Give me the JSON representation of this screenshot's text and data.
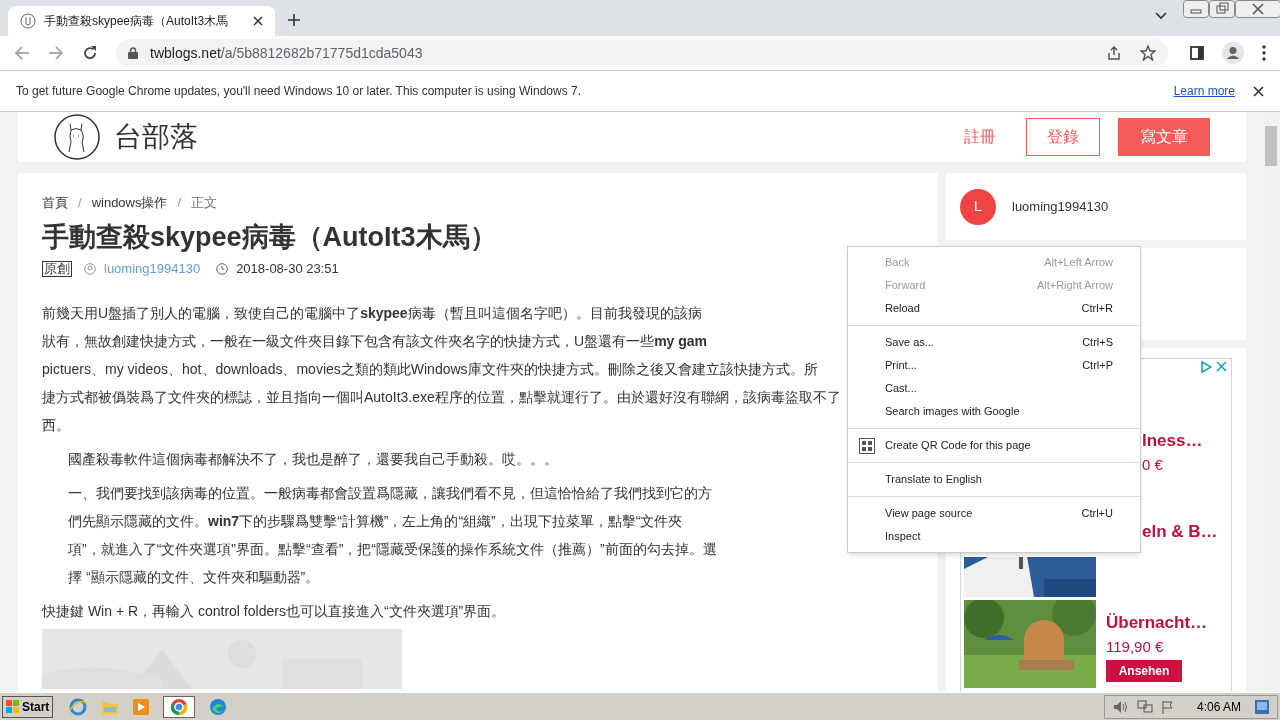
{
  "browser": {
    "tab": {
      "title": "手動查殺skypee病毒（AutoIt3木馬",
      "selected": true
    },
    "url_host": "twblogs.net",
    "url_path": "/a/5b8812682b71775d1cda5043"
  },
  "infobar": {
    "message": "To get future Google Chrome updates, you'll need Windows 10 or later. This computer is using Windows 7.",
    "link": "Learn more"
  },
  "site_header": {
    "logo_text": "台部落",
    "register": "註冊",
    "login": "登錄",
    "write": "寫文章"
  },
  "article": {
    "breadcrumb": [
      "首頁",
      "windows操作",
      "正文"
    ],
    "breadcrumb_separator": "/",
    "title": "手動查殺skypee病毒（AutoIt3木馬）",
    "badge": "原創",
    "author": "luoming1994130",
    "date": "2018-08-30 23:51",
    "paragraphs": [
      {
        "indent": false,
        "lines": [
          " 前幾天用U盤插了別人的電腦，致使自己的電腦中了**skypee**病毒（暫且叫這個名字吧）。目前我發現的該病",
          "狀有，無故創建快捷方式，一般在一級文件夾目錄下包含有該文件夾名字的快捷方式，U盤還有一些**my gam**",
          "pictuers、my videos、hot、downloads、movies之類的類此Windows庫文件夾的快捷方式。刪除之後又會建立該快捷方式。所",
          "捷方式都被僞裝爲了文件夾的標誌，並且指向一個叫AutoIt3.exe程序的位置，點擊就運行了。由於還好沒有聯網，該病毒盜取不了",
          "西。"
        ]
      },
      {
        "indent": true,
        "lines": [
          "國產殺毒軟件這個病毒都解決不了，我也是醉了，還要我自己手動殺。哎。。。"
        ]
      },
      {
        "indent": true,
        "lines": [
          " 一、我們要找到該病毒的位置。一般病毒都會設置爲隱藏，讓我們看不見，但這恰恰給了我們找到它的方",
          "們先顯示隱藏的文件。**win7**下的步驟爲雙擊“計算機”，左上角的“組織”，出現下拉菜單，點擊“文件夾",
          "項”，就進入了“文件夾選項”界面。點擊“查看”，把“隱藏受保護的操作系統文件（推薦）”前面的勾去掉。選",
          "擇 “顯示隱藏的文件、文件夾和驅動器”。"
        ]
      },
      {
        "indent": false,
        "lines": [
          "快捷鍵 Win + R，再輸入 control folders也可以直接進入“文件夾選項”界面。"
        ]
      }
    ]
  },
  "sidebar": {
    "user": {
      "initial": "L",
      "name": "luoming1994130"
    },
    "ads": [
      {
        "kind": "covered",
        "title": "lness…",
        "price": "0 €"
      },
      {
        "kind": "cut",
        "title": "eln & B…"
      },
      {
        "kind": "full",
        "title": "Übernacht…",
        "price": "119,90 €",
        "button": "Ansehen"
      }
    ]
  },
  "context_menu": {
    "groups": [
      [
        {
          "kind": "plain",
          "label": "Back",
          "shortcut": "Alt+Left Arrow",
          "disabled": true
        },
        {
          "kind": "plain",
          "label": "Forward",
          "shortcut": "Alt+Right Arrow",
          "disabled": true
        },
        {
          "kind": "plain",
          "label": "Reload",
          "shortcut": "Ctrl+R",
          "disabled": false
        }
      ],
      [
        {
          "kind": "plain",
          "label": "Save as...",
          "shortcut": "Ctrl+S",
          "disabled": false
        },
        {
          "kind": "plain",
          "label": "Print...",
          "shortcut": "Ctrl+P",
          "disabled": false
        },
        {
          "kind": "plain",
          "label": "Cast...",
          "disabled": false
        },
        {
          "kind": "plain",
          "label": "Search images with Google",
          "disabled": false
        }
      ],
      [
        {
          "kind": "qr",
          "label": "Create QR Code for this page",
          "disabled": false
        }
      ],
      [
        {
          "kind": "plain",
          "label": "Translate to English",
          "disabled": false
        }
      ],
      [
        {
          "kind": "plain",
          "label": "View page source",
          "shortcut": "Ctrl+U",
          "disabled": false
        },
        {
          "kind": "plain",
          "label": "Inspect",
          "disabled": false
        }
      ]
    ]
  },
  "taskbar": {
    "start": "Start",
    "clock": "4:06 AM"
  }
}
